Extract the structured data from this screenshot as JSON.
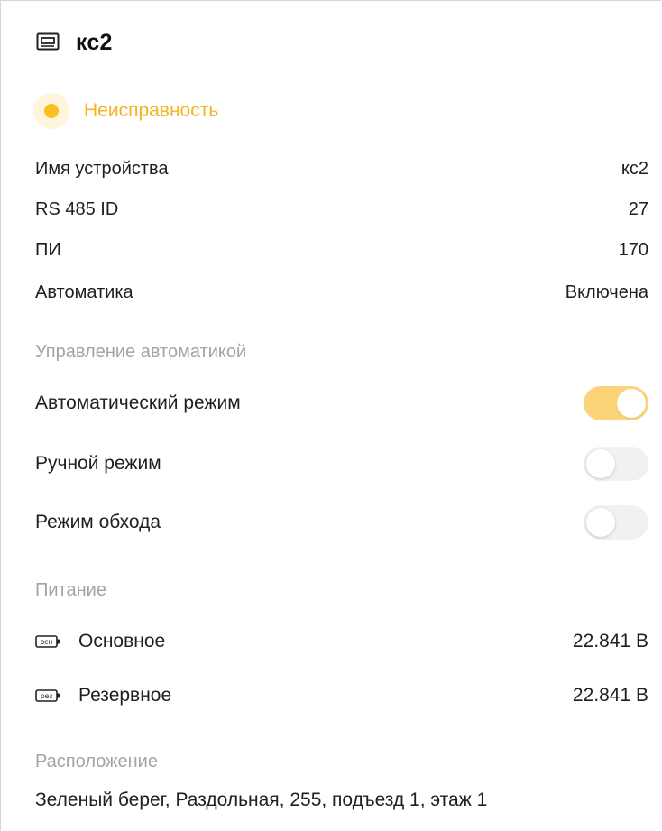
{
  "device": {
    "icon": "device-panel-icon",
    "title": "кс2"
  },
  "status": {
    "text": "Неисправность",
    "color": "#f5b320",
    "dot_color": "#fbbf24"
  },
  "info": [
    {
      "label": "Имя устройства",
      "value": "кс2"
    },
    {
      "label": "RS 485 ID",
      "value": "27"
    },
    {
      "label": "ПИ",
      "value": "170"
    },
    {
      "label": "Автоматика",
      "value": "Включена"
    }
  ],
  "automation": {
    "section_title": "Управление автоматикой",
    "toggles": [
      {
        "label": "Автоматический режим",
        "on": true
      },
      {
        "label": "Ручной режим",
        "on": false
      },
      {
        "label": "Режим обхода",
        "on": false
      }
    ],
    "accent_color": "#fdd37a"
  },
  "power": {
    "section_title": "Питание",
    "items": [
      {
        "icon_label": "осн",
        "label": "Основное",
        "value": "22.841 В",
        "icon": "battery-main-icon"
      },
      {
        "icon_label": "рез",
        "label": "Резервное",
        "value": "22.841 В",
        "icon": "battery-reserve-icon"
      }
    ]
  },
  "location": {
    "section_title": "Расположение",
    "text": "Зеленый берег, Раздольная, 255, подъезд 1, этаж 1"
  }
}
